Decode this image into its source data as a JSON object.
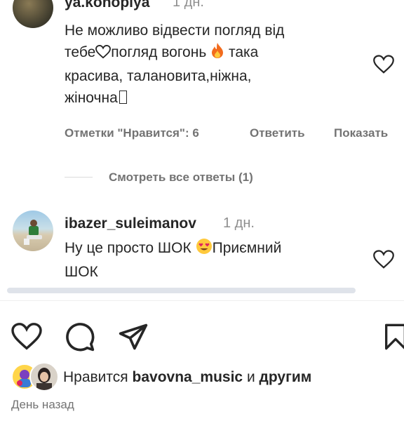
{
  "comments": [
    {
      "username": "ya.konopiya",
      "time": "1 дн.",
      "line1": "Не можливо відвести погляд від",
      "line2_a": "тебе",
      "line2_b": "погляд вогонь",
      "line2_c": "така",
      "line3": "красива, талановита,ніжна,",
      "line4": "жіночна",
      "likes_label": "Отметки \"Нравится\": 6",
      "reply_label": "Ответить",
      "show_label": "Показать"
    },
    {
      "username": "ibazer_suleimanov",
      "time": "1 дн.",
      "line1_a": "Ну це просто ШОК",
      "line1_b": "Приємний",
      "line2": "ШОК"
    }
  ],
  "view_replies": "Смотреть все ответы (1)",
  "likes": {
    "prefix": "Нравится",
    "user": "bavovna_music",
    "conj": "и",
    "others": "другим"
  },
  "post_date": "День назад",
  "icons": [
    "heart-icon",
    "comment-icon",
    "share-icon",
    "bookmark-icon",
    "fire-emoji-icon",
    "heart-eyes-emoji-icon"
  ]
}
